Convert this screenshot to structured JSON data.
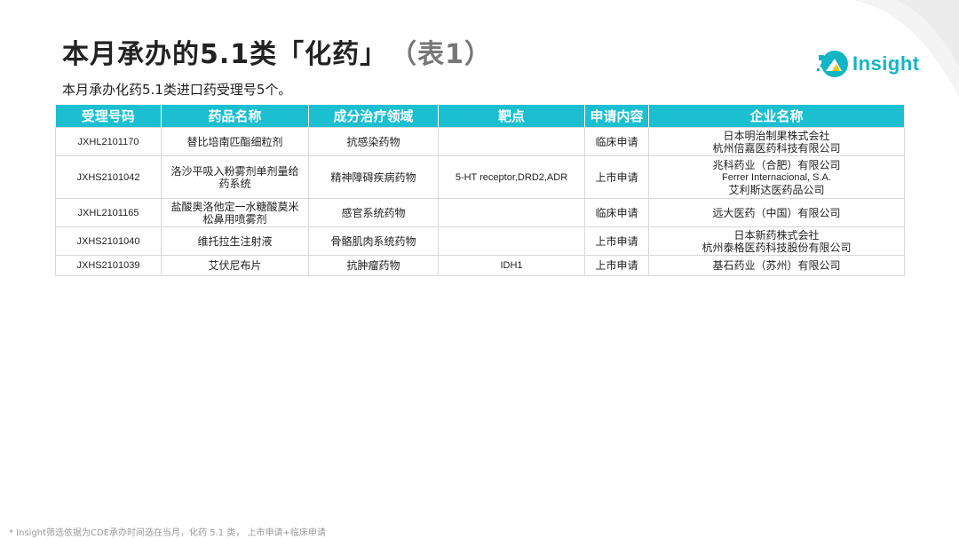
{
  "title": {
    "main": "本月承办的5.1类「化药」",
    "suffix": "（表1）"
  },
  "subtitle": "本月承办化药5.1类进口药受理号5个。",
  "logo": {
    "text": "Insight",
    "color": "#12b5c3"
  },
  "colors": {
    "header_bg": "#1bbfd0",
    "border": "#d9d9d9"
  },
  "table": {
    "headers": [
      "受理号码",
      "药品名称",
      "成分治疗领域",
      "靶点",
      "申请内容",
      "企业名称"
    ],
    "rows": [
      {
        "code": "JXHL2101170",
        "name": [
          "替比培南匹酯细粒剂"
        ],
        "area": "抗感染药物",
        "target": "",
        "type": "临床申请",
        "company": [
          "日本明治制果株式会社",
          "杭州倍嘉医药科技有限公司"
        ]
      },
      {
        "code": "JXHS2101042",
        "name": [
          "洛沙平吸入粉雾剂单剂量给",
          "药系统"
        ],
        "area": "精神障碍疾病药物",
        "target": "5-HT receptor,DRD2,ADR",
        "type": "上市申请",
        "company": [
          "兆科药业（合肥）有限公司",
          "Ferrer Internacional, S.A.",
          "艾利斯达医药品公司"
        ]
      },
      {
        "code": "JXHL2101165",
        "name": [
          "盐酸奥洛他定一水糖酸莫米",
          "松鼻用喷雾剂"
        ],
        "area": "感官系统药物",
        "target": "",
        "type": "临床申请",
        "company": [
          "远大医药（中国）有限公司"
        ]
      },
      {
        "code": "JXHS2101040",
        "name": [
          "维托拉生注射液"
        ],
        "area": "骨骼肌肉系统药物",
        "target": "",
        "type": "上市申请",
        "company": [
          "日本新药株式会社",
          "杭州泰格医药科技股份有限公司"
        ]
      },
      {
        "code": "JXHS2101039",
        "name": [
          "艾伏尼布片"
        ],
        "area": "抗肿瘤药物",
        "target": "IDH1",
        "type": "上市申请",
        "company": [
          "基石药业（苏州）有限公司"
        ]
      }
    ]
  },
  "footnote": "* Insight筛选依据为CDE承办时间选在当月，化药 5.1 类， 上市申请+临床申请"
}
